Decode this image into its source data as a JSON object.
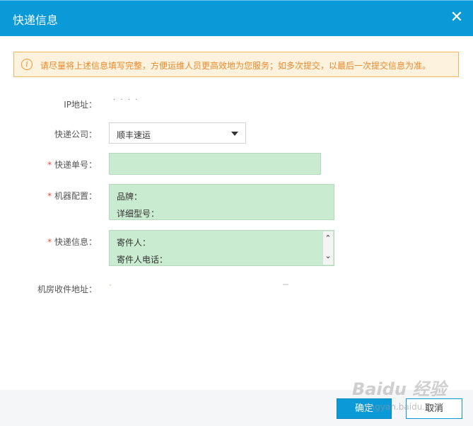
{
  "dialog": {
    "title": "快递信息"
  },
  "notice": {
    "text": "请尽量将上述信息填写完整，方便运维人员更高效地为您服务；如多次提交，以最后一次提交信息为准。"
  },
  "fields": {
    "ip": {
      "label": "IP地址：",
      "value": "· · · ·"
    },
    "company": {
      "label": "快递公司：",
      "value": "顺丰速运"
    },
    "tracking": {
      "required": "*",
      "label": "快递单号：",
      "value": ""
    },
    "machine": {
      "required": "*",
      "label": "机器配置：",
      "line1": "品牌：",
      "line2": "详细型号："
    },
    "shipping": {
      "required": "*",
      "label": "快递信息：",
      "line1": "寄件人：",
      "line2": "寄件人电话："
    },
    "address": {
      "label": "机房收件地址：",
      "value": "·"
    }
  },
  "buttons": {
    "ok": "确定",
    "cancel": "取消"
  },
  "watermark": {
    "brand": "Baidu 经验",
    "sub": "jingyan.baidu.com"
  },
  "colors": {
    "header": "#0a9ad8",
    "notice_text": "#e8892a",
    "field_bg": "#c9ebcf",
    "required": "#e84b3c"
  }
}
